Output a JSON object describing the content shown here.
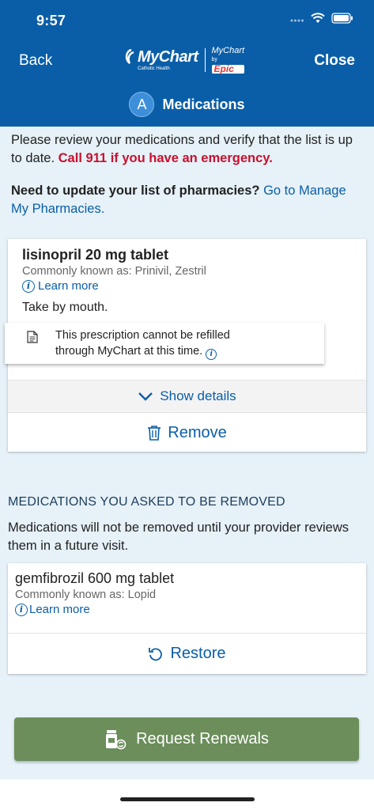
{
  "status_bar": {
    "time": "9:57"
  },
  "header": {
    "back_label": "Back",
    "close_label": "Close",
    "logo": {
      "brand": "MyChart",
      "sub": "Catholic Health",
      "partner_top": "MyChart",
      "partner_by": "by",
      "partner_bottom": "Epic"
    },
    "avatar_letter": "A",
    "page_title": "Medications"
  },
  "intro": {
    "text": "Please review your medications and verify that the list is up to date.",
    "emergency": "Call 911 if you have an emergency."
  },
  "pharmacies": {
    "question": "Need to update your list of pharmacies?",
    "link": "Go to Manage My Pharmacies."
  },
  "current_med": {
    "name": "lisinopril 20 mg tablet",
    "aka": "Commonly known as: Prinivil, Zestril",
    "learn_more": "Learn more",
    "instructions": "Take by mouth.",
    "refill_note_line1": "This prescription cannot be refilled",
    "refill_note_line2": "through MyChart at this time.",
    "show_details": "Show details",
    "remove": "Remove"
  },
  "removed_section": {
    "heading": "MEDICATIONS YOU ASKED TO BE REMOVED",
    "note": "Medications will not be removed until your provider reviews them in a future visit."
  },
  "removed_med": {
    "name": "gemfibrozil 600 mg tablet",
    "aka": "Commonly known as: Lopid",
    "learn_more": "Learn more",
    "restore": "Restore"
  },
  "footer": {
    "request_renewals": "Request Renewals"
  },
  "colors": {
    "header_bg": "#0a5ea8",
    "link": "#0a5ea8",
    "emergency": "#c8102e",
    "renew_button": "#6b8e5a",
    "page_bg": "#e6f1f8"
  }
}
